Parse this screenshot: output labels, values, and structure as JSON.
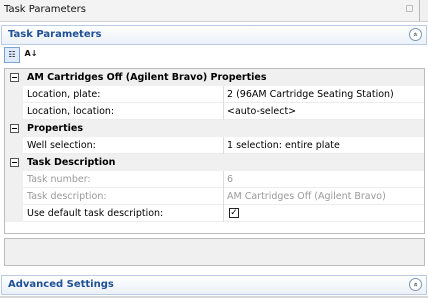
{
  "tab": {
    "title": "Task Parameters"
  },
  "panel": {
    "title": "Task Parameters",
    "collapse_glyph": "«"
  },
  "toolbar": {
    "categorized_glyph": "☷",
    "alphabetical_glyph": "A↓"
  },
  "grid": {
    "cat1": {
      "label": "AM Cartridges Off (Agilent Bravo) Properties",
      "rows": [
        {
          "name": "Location, plate:",
          "value": "2  (96AM Cartridge Seating Station)"
        },
        {
          "name": "Location, location:",
          "value": "<auto-select>"
        }
      ]
    },
    "cat2": {
      "label": "Properties",
      "rows": [
        {
          "name": "Well selection:",
          "value": "1 selection: entire plate"
        }
      ]
    },
    "cat3": {
      "label": "Task Description",
      "rows": [
        {
          "name": "Task number:",
          "value": "6"
        },
        {
          "name": "Task description:",
          "value": "AM Cartridges Off (Agilent Bravo)"
        },
        {
          "name": "Use default task description:",
          "value": "",
          "checked": true
        }
      ]
    }
  },
  "advanced": {
    "title": "Advanced Settings",
    "expand_glyph": "»"
  },
  "checkbox_glyph": "✓"
}
